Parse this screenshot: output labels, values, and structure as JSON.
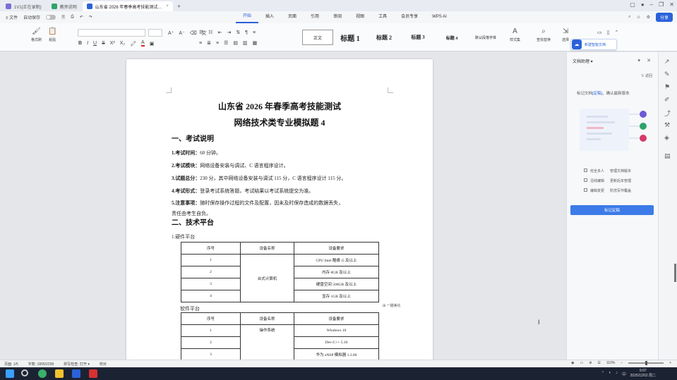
{
  "tabs": [
    {
      "label": "1V1(正在录制)",
      "color": "#7b6fd6"
    },
    {
      "label": "教师说明",
      "color": "#2fa36b"
    },
    {
      "label": "山东省 2026 年春季高考技能测试…",
      "color": "#2b62d9",
      "active": true
    }
  ],
  "new_tab": "+",
  "menubar": {
    "file": "≡ 文件",
    "autosave": "自动保存",
    "menus": [
      "开始",
      "插入",
      "页面",
      "引用",
      "审阅",
      "视图",
      "工具",
      "会员专享",
      "WPS AI"
    ],
    "active_menu": "开始",
    "share": "分享"
  },
  "ribbon": {
    "paste": "格式刷",
    "clipboard": "粘贴",
    "styles": [
      {
        "label": "正文",
        "cls": "first"
      },
      {
        "label": "标题 1",
        "cls": "s1"
      },
      {
        "label": "标题 2",
        "cls": "s2"
      },
      {
        "label": "标题 3",
        "cls": "s3"
      },
      {
        "label": "标题 4",
        "cls": "s4"
      },
      {
        "label": "默认段落字体",
        "cls": "s5"
      }
    ],
    "style_set": "样式集",
    "find": "查找替换",
    "select": "选择"
  },
  "doc": {
    "title1": "山东省  2026  年春季高考技能测试",
    "title2": "网络技术类专业模拟题 4",
    "section1": "一、考试说明",
    "items": [
      {
        "k": "1.考试时间：",
        "v": "60 分钟。"
      },
      {
        "k": "2.考试模块：",
        "v": "网络设备安装与调试、C 语言程序设计。"
      },
      {
        "k": "3.试题总分：",
        "v": "230 分，其中网络设备安装与调试 115 分，C 语言程序设计 115 分。"
      },
      {
        "k": "4.考试形式：",
        "v": "登录考试系统答题，考试结果以考试系统提交为准。"
      },
      {
        "k": "5.注意事项：",
        "v": "随时保存操作过程的文件及配置，因未及时保存造成的数据丢失，"
      }
    ],
    "item5_cont": "责任由考生自负。",
    "section2": "二、技术平台",
    "hw_label": "1.硬件平台",
    "hw_headers": [
      "序号",
      "设备名称",
      "设备要求"
    ],
    "hw_device": "台式计算机",
    "hw_rows": [
      {
        "no": "1",
        "req": "CPU  Intel 酷睿 i5 及以上"
      },
      {
        "no": "2",
        "req": "内存 8GB 及以上"
      },
      {
        "no": "3",
        "req": "硬盘空间 500GB 及以上"
      },
      {
        "no": "4",
        "req": "显存 1GB 及以上"
      }
    ],
    "sw_label": "软件平台",
    "sw_headers": [
      "序号",
      "设备名称",
      "设备要求"
    ],
    "sw_device": "操作系统",
    "sw_rows": [
      {
        "no": "1",
        "req": "Windows 10"
      },
      {
        "no": "2",
        "req": "Dev-C++ 5.10"
      },
      {
        "no": "3",
        "req": "华为 eNSP 模拟器 1.3.00"
      }
    ],
    "beautify": "一键美化"
  },
  "panel": {
    "title": "文档助理 ▾",
    "back": "返回",
    "desc_pre": "标记文档",
    "desc_link": "[定稿]",
    "desc_post": "，确认最新版本",
    "checks": [
      [
        "完全多人",
        "管理文档版本"
      ],
      [
        "沿线编辑",
        "更新后本管理"
      ],
      [
        "编辑变更",
        "防范写作覆盖"
      ]
    ],
    "button": "标记定稿",
    "bubble": "新建智能文档"
  },
  "status": {
    "page": "页面: 1/5",
    "words": "字数: 1805/2258",
    "spell": "拼写检查: 打开 ▾",
    "proof": "校对",
    "zoom": "110%"
  },
  "taskbar": {
    "time": "9:07",
    "date": "2025/12/02 周二"
  }
}
